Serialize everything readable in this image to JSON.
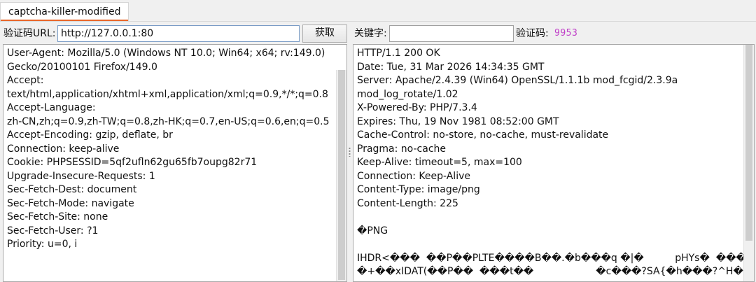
{
  "tab": {
    "label": "captcha-killer-modified"
  },
  "toolbar": {
    "url_label": "验证码URL:",
    "url_value": "http://127.0.0.1:80",
    "fetch_button": "获取",
    "keyword_label": "关键字:",
    "keyword_value": "",
    "captcha_label": "验证码:",
    "captcha_value": "9953"
  },
  "request_panel": {
    "lines": [
      "User-Agent: Mozilla/5.0 (Windows NT 10.0; Win64; x64; rv:149.0)",
      "Gecko/20100101 Firefox/149.0",
      "Accept:",
      "text/html,application/xhtml+xml,application/xml;q=0.9,*/*;q=0.8",
      "Accept-Language:",
      "zh-CN,zh;q=0.9,zh-TW;q=0.8,zh-HK;q=0.7,en-US;q=0.6,en;q=0.5",
      "Accept-Encoding: gzip, deflate, br",
      "Connection: keep-alive",
      "Cookie: PHPSESSID=5qf2ufln62gu65fb7oupg82r71",
      "Upgrade-Insecure-Requests: 1",
      "Sec-Fetch-Dest: document",
      "Sec-Fetch-Mode: navigate",
      "Sec-Fetch-Site: none",
      "Sec-Fetch-User: ?1",
      "Priority: u=0, i"
    ]
  },
  "response_panel": {
    "lines": [
      "HTTP/1.1 200 OK",
      "Date: Tue, 31 Mar 2026 14:34:35 GMT",
      "Server: Apache/2.4.39 (Win64) OpenSSL/1.1.1b mod_fcgid/2.3.9a",
      "mod_log_rotate/1.02",
      "X-Powered-By: PHP/7.3.4",
      "Expires: Thu, 19 Nov 1981 08:52:00 GMT",
      "Cache-Control: no-store, no-cache, must-revalidate",
      "Pragma: no-cache",
      "Keep-Alive: timeout=5, max=100",
      "Connection: Keep-Alive",
      "Content-Type: image/png",
      "Content-Length: 225",
      "",
      "�PNG",
      "",
      "IHDR<���  ��P��PLTE����B��.�b���q �|�          pHYs�  ���",
      "�+��xIDAT(��P��  ���t��                    �c���?SA{�h���?^H��"
    ]
  }
}
